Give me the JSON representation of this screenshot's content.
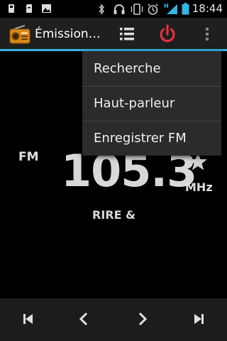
{
  "status_bar": {
    "time": "18:44",
    "icons": [
      "usb-icon",
      "sd-card-icon",
      "image-icon",
      "bluetooth-icon",
      "headset-icon",
      "vibrate-icon",
      "alarm-icon",
      "signal-icon",
      "battery-icon"
    ],
    "signal_type": "H"
  },
  "action_bar": {
    "title": "Émission…",
    "app_icon": "radio-icon",
    "power_color": "#e8303a",
    "accent_color": "#33b5e5"
  },
  "menu": {
    "items": [
      {
        "label": "Recherche"
      },
      {
        "label": "Haut-parleur"
      },
      {
        "label": "Enregistrer FM"
      }
    ]
  },
  "tuner": {
    "band": "FM",
    "frequency": "105.3",
    "unit": "MHz",
    "rds_text": "RIRE &"
  },
  "controls": {
    "buttons": [
      "skip-previous-icon",
      "chevron-left-icon",
      "chevron-right-icon",
      "skip-next-icon"
    ]
  }
}
